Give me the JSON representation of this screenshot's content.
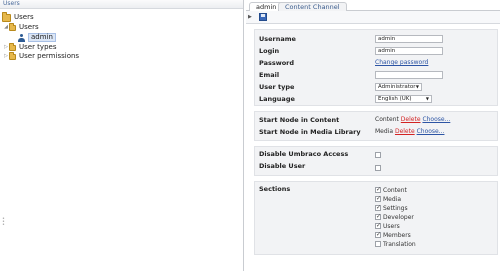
{
  "tree": {
    "header": "Users",
    "root": "Users",
    "users_folder": "Users",
    "admin": "admin",
    "user_types": "User types",
    "user_permissions": "User permissions"
  },
  "tabs": [
    "admin",
    "Content Channel"
  ],
  "form": {
    "username": {
      "label": "Username",
      "value": "admin"
    },
    "login": {
      "label": "Login",
      "value": "admin"
    },
    "password": {
      "label": "Password",
      "link": "Change password"
    },
    "email": {
      "label": "Email",
      "value": ""
    },
    "user_type": {
      "label": "User type",
      "value": "Administrator"
    },
    "language": {
      "label": "Language",
      "value": "English (UK)"
    }
  },
  "start_nodes": {
    "content": {
      "label": "Start Node in Content",
      "value": "Content",
      "delete": "Delete",
      "choose": "Choose..."
    },
    "media": {
      "label": "Start Node in Media Library",
      "value": "Media",
      "delete": "Delete",
      "choose": "Choose..."
    }
  },
  "access": {
    "disable_umbraco": {
      "label": "Disable Umbraco Access",
      "checked": false
    },
    "disable_user": {
      "label": "Disable User",
      "checked": false
    }
  },
  "sections": {
    "label": "Sections",
    "items": [
      {
        "label": "Content",
        "checked": true
      },
      {
        "label": "Media",
        "checked": true
      },
      {
        "label": "Settings",
        "checked": true
      },
      {
        "label": "Developer",
        "checked": true
      },
      {
        "label": "Users",
        "checked": true
      },
      {
        "label": "Members",
        "checked": true
      },
      {
        "label": "Translation",
        "checked": false
      }
    ]
  },
  "icons": {
    "folder": "folder-icon",
    "user": "user-icon",
    "save": "save-icon"
  }
}
